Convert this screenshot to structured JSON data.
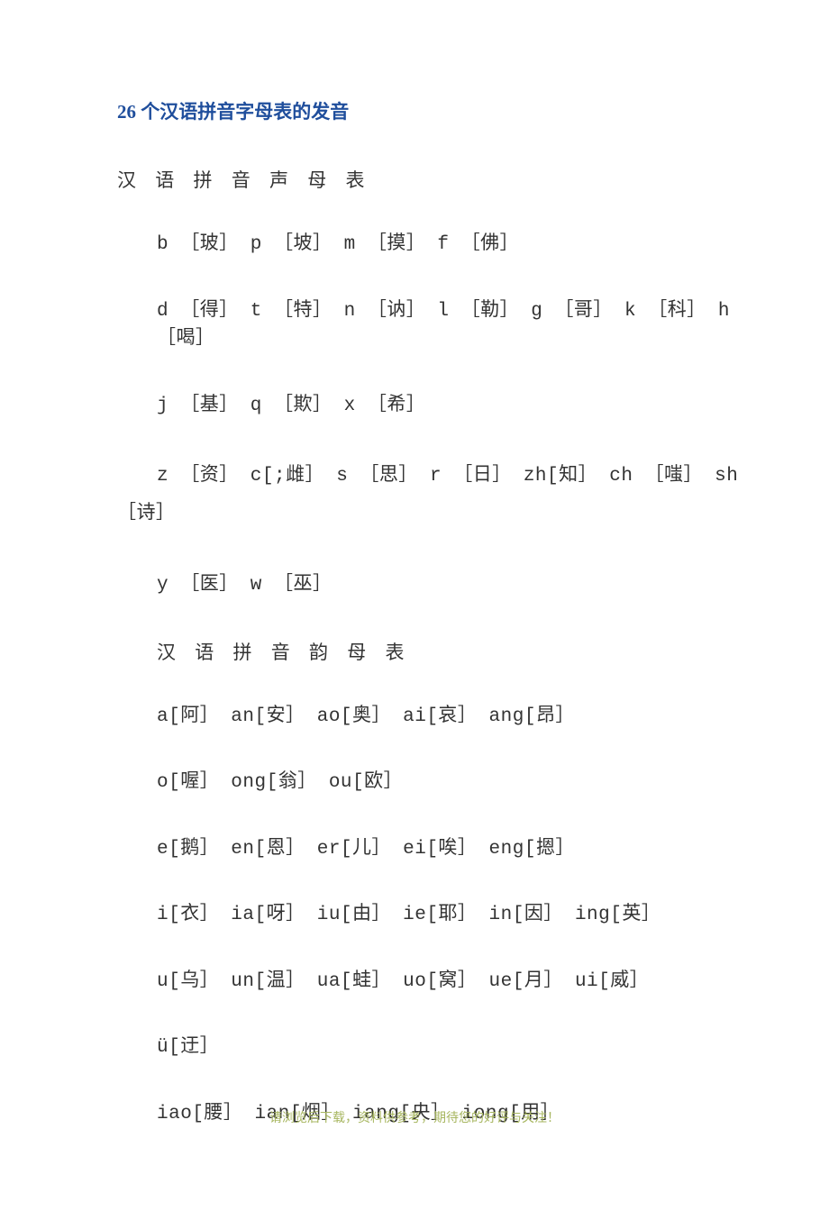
{
  "title": "26 个汉语拼音字母表的发音",
  "subtitle_initials": "汉 语 拼 音 声 母 表",
  "lines_initials": [
    "b ［玻］ p ［坡］ m ［摸］ f ［佛］",
    "d ［得］ t ［特］ n ［讷］ l ［勒］ g ［哥］ k ［科］ h ［喝］",
    "j ［基］ q ［欺］ x ［希］"
  ],
  "line_z": "z ［资］ c[;雌］ s ［思］ r ［日］ zh[知］ ch ［嗤］ sh ［诗］",
  "line_yw": "y ［医］ w ［巫］",
  "subtitle_finals": "汉 语 拼 音 韵 母 表",
  "lines_finals": [
    "a[阿］ an[安］ ao[奥］ ai[哀］ ang[昂］",
    "o[喔］ ong[翁］ ou[欧］",
    "e[鹅］ en[恩］ er[儿］ ei[唉］ eng[摁］",
    "i[衣］ ia[呀］ iu[由］ ie[耶］ in[因］ ing[英］",
    "u[乌］ un[温］ ua[蛙］ uo[窝］ ue[月］ ui[威］",
    "ü[迂］",
    "iao[腰］ ian[烟］ iang[央］ iong[用］"
  ],
  "footer": "请浏览后下载，资料供参考，期待您的好评与关注！"
}
